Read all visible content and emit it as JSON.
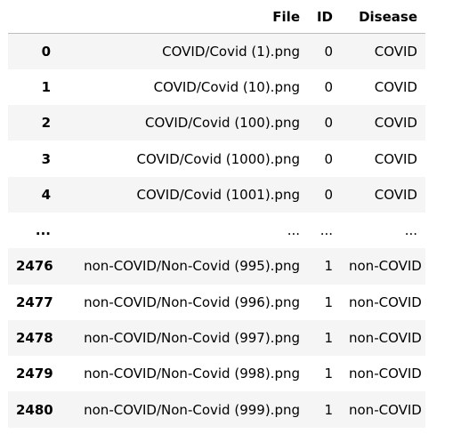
{
  "table": {
    "columns": [
      "",
      "File",
      "ID",
      "Disease"
    ],
    "rows": [
      {
        "index": "0",
        "file": "COVID/Covid (1).png",
        "id": "0",
        "disease": "COVID"
      },
      {
        "index": "1",
        "file": "COVID/Covid (10).png",
        "id": "0",
        "disease": "COVID"
      },
      {
        "index": "2",
        "file": "COVID/Covid (100).png",
        "id": "0",
        "disease": "COVID"
      },
      {
        "index": "3",
        "file": "COVID/Covid (1000).png",
        "id": "0",
        "disease": "COVID"
      },
      {
        "index": "4",
        "file": "COVID/Covid (1001).png",
        "id": "0",
        "disease": "COVID"
      },
      {
        "index": "...",
        "file": "...",
        "id": "...",
        "disease": "..."
      },
      {
        "index": "2476",
        "file": "non-COVID/Non-Covid (995).png",
        "id": "1",
        "disease": "non-COVID"
      },
      {
        "index": "2477",
        "file": "non-COVID/Non-Covid (996).png",
        "id": "1",
        "disease": "non-COVID"
      },
      {
        "index": "2478",
        "file": "non-COVID/Non-Covid (997).png",
        "id": "1",
        "disease": "non-COVID"
      },
      {
        "index": "2479",
        "file": "non-COVID/Non-Covid (998).png",
        "id": "1",
        "disease": "non-COVID"
      },
      {
        "index": "2480",
        "file": "non-COVID/Non-Covid (999).png",
        "id": "1",
        "disease": "non-COVID"
      }
    ]
  }
}
